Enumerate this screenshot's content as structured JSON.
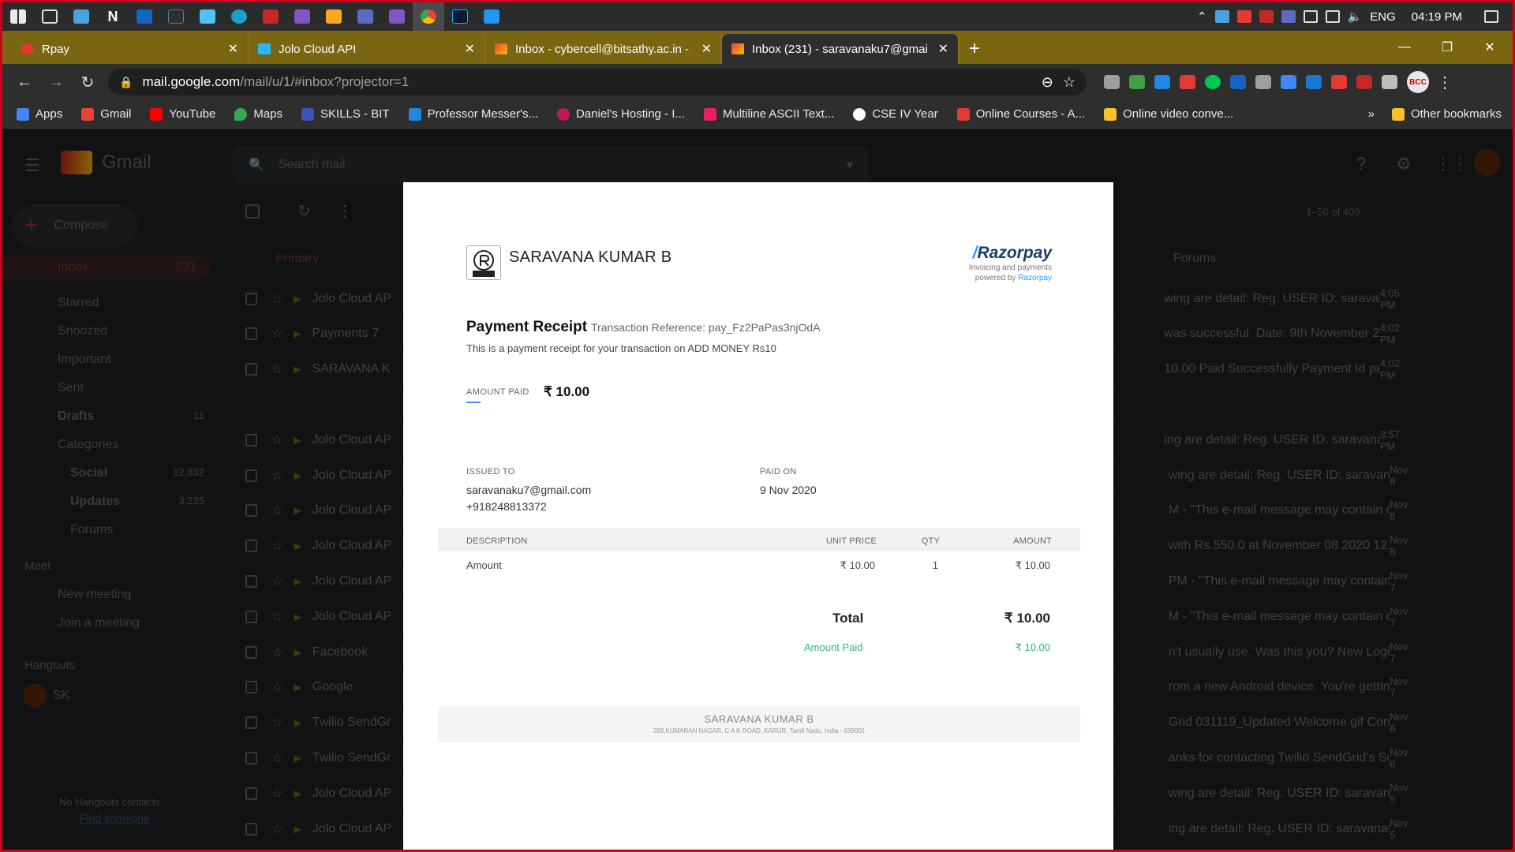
{
  "taskbar": {
    "apps": [
      "windows-start",
      "task-view",
      "windows-app",
      "netflix-n",
      "app-blue",
      "app-dark",
      "photos",
      "edge",
      "app-red",
      "visual-studio",
      "file-explorer",
      "teams",
      "visual-studio-2",
      "chrome",
      "photoshop",
      "vscode"
    ],
    "tray": {
      "language": "ENG",
      "time": "04:19 PM"
    }
  },
  "tabs": [
    {
      "title": "Rpay",
      "active": false
    },
    {
      "title": "Jolo Cloud API",
      "active": false
    },
    {
      "title": "Inbox - cybercell@bitsathy.ac.in -",
      "active": false
    },
    {
      "title": "Inbox (231) - saravanaku7@gmai",
      "active": true
    }
  ],
  "address": {
    "url_main": "mail.google.com",
    "url_rest": "/mail/u/1/#inbox?projector=1"
  },
  "bookmarks": [
    {
      "label": "Apps",
      "color": "#4285f4"
    },
    {
      "label": "Gmail",
      "color": "#ea4335"
    },
    {
      "label": "YouTube",
      "color": "#ff0000"
    },
    {
      "label": "Maps",
      "color": "#34a853"
    },
    {
      "label": "SKILLS - BIT",
      "color": "#3f51b5"
    },
    {
      "label": "Professor Messer's...",
      "color": "#1e88e5"
    },
    {
      "label": "Daniel's Hosting - I...",
      "color": "#c2185b"
    },
    {
      "label": "Multiline ASCII Text...",
      "color": "#e91e63"
    },
    {
      "label": "CSE IV Year",
      "color": "#ffffff"
    },
    {
      "label": "Online Courses - A...",
      "color": "#e53935"
    },
    {
      "label": "Online video conve...",
      "color": "#fbc02d"
    }
  ],
  "bookmarks_more": "»",
  "other_bookmarks": "Other bookmarks",
  "gmail": {
    "brand": "Gmail",
    "search_placeholder": "Search mail",
    "compose": "Compose",
    "pagination": "1–50 of 409",
    "categories": {
      "primary": "Primary",
      "forums": "Forums"
    },
    "nav": [
      {
        "label": "Inbox",
        "count": "231"
      },
      {
        "label": "Starred",
        "count": ""
      },
      {
        "label": "Snoozed",
        "count": ""
      },
      {
        "label": "Important",
        "count": ""
      },
      {
        "label": "Sent",
        "count": ""
      },
      {
        "label": "Drafts",
        "count": "11"
      },
      {
        "label": "Categories",
        "count": ""
      },
      {
        "label": "Social",
        "count": "12,832"
      },
      {
        "label": "Updates",
        "count": "3,235"
      },
      {
        "label": "Forums",
        "count": ""
      }
    ],
    "meet": {
      "title": "Meet",
      "new": "New meeting",
      "join": "Join a meeting"
    },
    "hangouts": {
      "title": "Hangouts",
      "user": "SK",
      "empty": "No Hangouts contacts",
      "find": "Find someone"
    },
    "mails": [
      {
        "sender": "Jolo Cloud AP",
        "snippet": "wing are detail: Reg. USER ID: saravana0...",
        "time": "4:05 PM"
      },
      {
        "sender": "Payments 7",
        "snippet": "was successful. Date: 9th November 20...",
        "time": "4:02 PM"
      },
      {
        "sender": "SARAVANA K",
        "snippet": "10.00 Paid Successfully Payment Id pay_...",
        "time": "4:02 PM"
      },
      {
        "sender": "",
        "snippet": "",
        "time": ""
      },
      {
        "sender": "Jolo Cloud AP",
        "snippet": "ing are detail: Reg. USER ID: saravana07 ...",
        "time": "3:57 PM"
      },
      {
        "sender": "Jolo Cloud AP",
        "snippet": "wing are detail: Reg. USER ID: saravana07...",
        "time": "Nov 8"
      },
      {
        "sender": "Jolo Cloud AP",
        "snippet": "M - \"This e-mail message may contain c...",
        "time": "Nov 8"
      },
      {
        "sender": "Jolo Cloud AP",
        "snippet": "with Rs.550.0 at November 08 2020 12...",
        "time": "Nov 8"
      },
      {
        "sender": "Jolo Cloud AP",
        "snippet": "PM - \"This e-mail message may contain c...",
        "time": "Nov 7"
      },
      {
        "sender": "Jolo Cloud AP",
        "snippet": "M - \"This e-mail message may contain c...",
        "time": "Nov 7"
      },
      {
        "sender": "Facebook",
        "snippet": "n't usually use. Was this you? New Logi...",
        "time": "Nov 7"
      },
      {
        "sender": "Google",
        "snippet": "rom a new Android device. You're gettin...",
        "time": "Nov 7"
      },
      {
        "sender": "Twilio SendGr",
        "snippet": "Grid 031119_Updated Welcome.gif Cong...",
        "time": "Nov 6"
      },
      {
        "sender": "Twilio SendGr",
        "snippet": "anks for contacting Twilio SendGrid's Su...",
        "time": "Nov 6"
      },
      {
        "sender": "Jolo Cloud AP",
        "snippet": "wing are detail: Reg. USER ID: saravana07...",
        "time": "Nov 5"
      },
      {
        "sender": "Jolo Cloud AP",
        "snippet": "ing are detail: Reg. USER ID: saravana07 ...",
        "time": "Nov 5"
      }
    ]
  },
  "receipt": {
    "merchant": "SARAVANA KUMAR B",
    "logo_text": "RPAY",
    "razorpay": {
      "brand": "Razorpay",
      "tag1": "Invoicing and payments",
      "tag2_prefix": "powered by ",
      "tag2_link": "Razorpay"
    },
    "title": "Payment Receipt",
    "tx_ref": "Transaction Reference: pay_Fz2PaPas3njOdA",
    "desc": "This is a payment receipt for your transaction on ADD MONEY Rs10",
    "amount_label": "AMOUNT PAID",
    "amount": "₹ 10.00",
    "issued_label": "ISSUED TO",
    "email": "saravanaku7@gmail.com",
    "phone": "+918248813372",
    "paid_on_label": "PAID ON",
    "paid_on": "9 Nov 2020",
    "table": {
      "headers": {
        "description": "DESCRIPTION",
        "unit_price": "UNIT PRICE",
        "qty": "QTY",
        "amount": "AMOUNT"
      },
      "row": {
        "description": "Amount",
        "unit_price": "₹ 10.00",
        "qty": "1",
        "amount": "₹ 10.00"
      }
    },
    "total_label": "Total",
    "total": "₹ 10.00",
    "paid_label": "Amount Paid",
    "paid": "₹ 10.00",
    "footer_name": "SARAVANA KUMAR B",
    "footer_addr": "289,KUMARAN NAGAR, C A K ROAD, KARUR, Tamil Nadu, India - 639001"
  }
}
